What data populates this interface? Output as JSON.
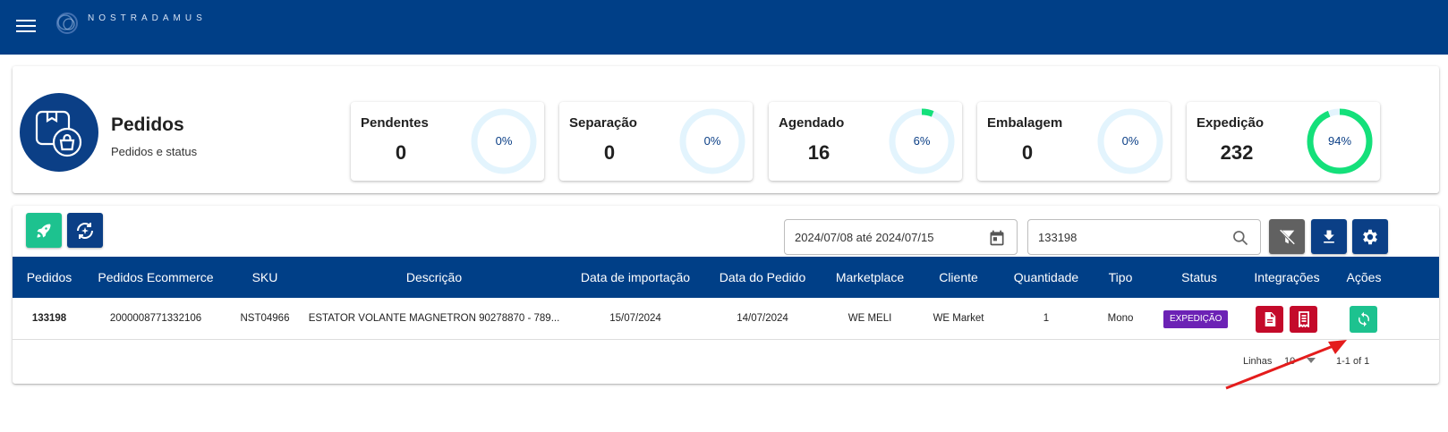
{
  "app": {
    "brand": "NOSTRADAMUS"
  },
  "page": {
    "title": "Pedidos",
    "subtitle": "Pedidos e status"
  },
  "stats": [
    {
      "label": "Pendentes",
      "value": "0",
      "percent_text": "0%",
      "percent": 0
    },
    {
      "label": "Separação",
      "value": "0",
      "percent_text": "0%",
      "percent": 0
    },
    {
      "label": "Agendado",
      "value": "16",
      "percent_text": "6%",
      "percent": 6
    },
    {
      "label": "Embalagem",
      "value": "0",
      "percent_text": "0%",
      "percent": 0
    },
    {
      "label": "Expedição",
      "value": "232",
      "percent_text": "94%",
      "percent": 94
    }
  ],
  "filters": {
    "date_range": "2024/07/08 até 2024/07/15",
    "search_value": "133198"
  },
  "table": {
    "columns": [
      "Pedidos",
      "Pedidos Ecommerce",
      "SKU",
      "Descrição",
      "Data de importação",
      "Data do Pedido",
      "Marketplace",
      "Cliente",
      "Quantidade",
      "Tipo",
      "Status",
      "Integrações",
      "Ações"
    ],
    "rows": [
      {
        "pedido": "133198",
        "ecommerce": "2000008771332106",
        "sku": "NST04966",
        "descricao": "ESTATOR VOLANTE MAGNETRON 90278870 - 789...",
        "data_importacao": "15/07/2024",
        "data_pedido": "14/07/2024",
        "marketplace": "WE MELI",
        "cliente": "WE Market",
        "quantidade": "1",
        "tipo": "Mono",
        "status": "EXPEDIÇÃO"
      }
    ]
  },
  "pagination": {
    "rows_label": "Linhas",
    "rows_value": "10",
    "range": "1-1 of 1"
  },
  "colors": {
    "primary": "#003f87",
    "accent_green": "#1dc28f",
    "ring_green": "#14e07a",
    "ring_track": "#e3f4fd",
    "danger": "#c40a2a",
    "status_purple": "#6c22b5"
  },
  "icons": [
    "menu-icon",
    "logo-icon",
    "bag-box-icon",
    "rocket-icon",
    "sync-sparkle-icon",
    "calendar-icon",
    "search-icon",
    "filter-off-icon",
    "download-icon",
    "gear-icon",
    "document-icon",
    "receipt-icon",
    "refresh-icon",
    "caret-down-icon"
  ]
}
